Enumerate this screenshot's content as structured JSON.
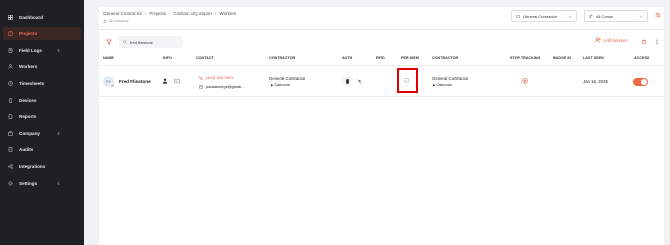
{
  "sidebar": {
    "items": [
      {
        "label": "Dashboard",
        "icon": "dashboard-icon",
        "active": false,
        "has_submenu": false
      },
      {
        "label": "Projects",
        "icon": "projects-icon",
        "active": true,
        "has_submenu": false
      },
      {
        "label": "Field Logs",
        "icon": "field-logs-icon",
        "active": false,
        "has_submenu": true
      },
      {
        "label": "Workers",
        "icon": "workers-icon",
        "active": false,
        "has_submenu": false
      },
      {
        "label": "Timesheets",
        "icon": "timesheets-icon",
        "active": false,
        "has_submenu": false
      },
      {
        "label": "Devices",
        "icon": "devices-icon",
        "active": false,
        "has_submenu": false
      },
      {
        "label": "Reports",
        "icon": "reports-icon",
        "active": false,
        "has_submenu": false
      },
      {
        "label": "Company",
        "icon": "company-icon",
        "active": false,
        "has_submenu": true
      },
      {
        "label": "Audits",
        "icon": "audits-icon",
        "active": false,
        "has_submenu": false
      },
      {
        "label": "Integrations",
        "icon": "integrations-icon",
        "active": false,
        "has_submenu": false
      },
      {
        "label": "Settings",
        "icon": "settings-icon",
        "active": false,
        "has_submenu": true
      }
    ]
  },
  "header": {
    "breadcrumb": [
      "General Contractor",
      "Projects",
      "Gotham city airport",
      "Workers"
    ],
    "subcount": "All company",
    "contractor_select": "General Contractor",
    "crews_select": "All Crews"
  },
  "toolbar": {
    "search_value": "fred flinstone",
    "add_worker_label": "Add Worker"
  },
  "table": {
    "columns": {
      "name": "NAME",
      "info": "INFO",
      "contact": "CONTACT",
      "contractor": "CONTRACTOR",
      "auth": "AUTH",
      "rfid": "RFID",
      "per_diem": "PER DIEM",
      "contractor2": "CONTRACTOR",
      "stop_tracking": "STOP TRACKING",
      "badge_id": "BADGE ID",
      "last_seen": "LAST SEEN",
      "access": "ACCESS"
    },
    "rows": [
      {
        "initials": "FF",
        "name": "Fred Flinstone",
        "phone": "(443) 315-9921",
        "email": "paulasmegs@gmail....",
        "contractor": "General Contractor",
        "contractor_sub": "Cartoons",
        "contractor2": "General Contractor",
        "contractor2_sub": "Cartoons",
        "badge_id": "",
        "last_seen": "Jan 16, 2025",
        "access_on": true
      }
    ]
  },
  "colors": {
    "accent": "#ee6a40",
    "sidebar_bg": "#1f2023",
    "highlight_box": "#e10000"
  }
}
